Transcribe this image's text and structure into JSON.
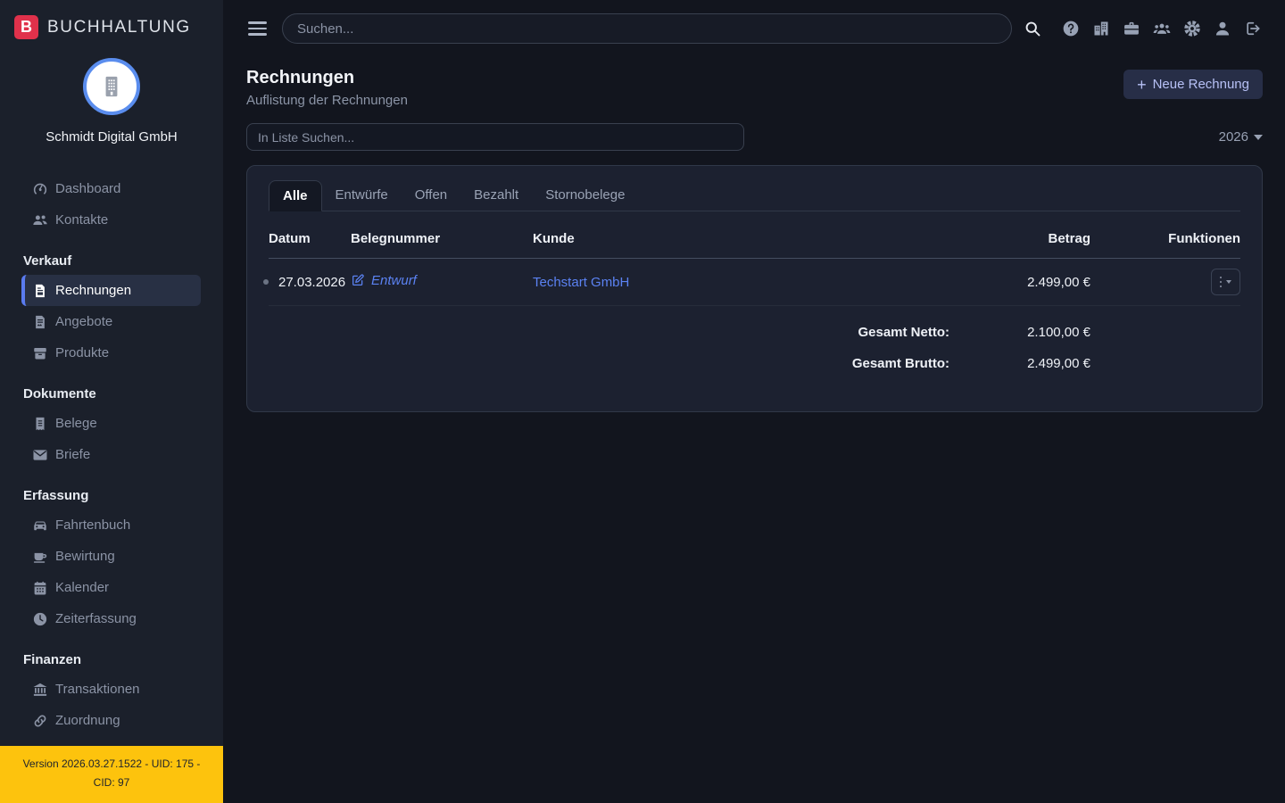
{
  "app": {
    "brand": "BUCHHALTUNG",
    "logo_letter": "B"
  },
  "colors": {
    "accent_blue": "#5b82f2",
    "active_item_bar": "#5a7bf0",
    "avatar_ring": "#5a8dee",
    "version_bar_yellow": "#fdc30d",
    "logo_red": "#e0314b",
    "card_bg": "#1c2130",
    "page_bg": "#12151e",
    "sidebar_bg": "#1b202b"
  },
  "topbar": {
    "search_placeholder": "Suchen...",
    "icons": [
      "hamburger-icon",
      "search-icon",
      "help-circle-icon",
      "city-icon",
      "briefcase-icon",
      "users-icon",
      "gear-icon",
      "user-icon",
      "sign-out-icon"
    ]
  },
  "sidebar": {
    "company_name": "Schmidt Digital GmbH",
    "top_items": [
      {
        "label": "Dashboard",
        "icon": "gauge-icon"
      },
      {
        "label": "Kontakte",
        "icon": "users-icon"
      }
    ],
    "sections": [
      {
        "title": "Verkauf",
        "items": [
          {
            "label": "Rechnungen",
            "icon": "file-invoice-icon",
            "active": true
          },
          {
            "label": "Angebote",
            "icon": "file-lines-icon"
          },
          {
            "label": "Produkte",
            "icon": "box-icon"
          }
        ]
      },
      {
        "title": "Dokumente",
        "items": [
          {
            "label": "Belege",
            "icon": "receipt-icon"
          },
          {
            "label": "Briefe",
            "icon": "envelope-icon"
          }
        ]
      },
      {
        "title": "Erfassung",
        "items": [
          {
            "label": "Fahrtenbuch",
            "icon": "car-icon"
          },
          {
            "label": "Bewirtung",
            "icon": "coffee-icon"
          },
          {
            "label": "Kalender",
            "icon": "calendar-icon"
          },
          {
            "label": "Zeiterfassung",
            "icon": "clock-icon"
          }
        ]
      },
      {
        "title": "Finanzen",
        "items": [
          {
            "label": "Transaktionen",
            "icon": "bank-icon"
          },
          {
            "label": "Zuordnung",
            "icon": "link-icon"
          }
        ]
      }
    ],
    "version_text": "Version 2026.03.27.1522 - UID: 175 - CID: 97"
  },
  "page": {
    "title": "Rechnungen",
    "subtitle": "Auflistung der Rechnungen",
    "new_button_plus": "+",
    "new_button_label": "Neue Rechnung",
    "list_search_placeholder": "In Liste Suchen...",
    "year_filter": "2026"
  },
  "invoice_card": {
    "tabs": [
      "Alle",
      "Entwürfe",
      "Offen",
      "Bezahlt",
      "Stornobelege"
    ],
    "active_tab": "Alle",
    "table": {
      "headers": [
        "Datum",
        "Belegnummer",
        "Kunde",
        "Betrag",
        "Funktionen"
      ],
      "rows": [
        {
          "datum": "27.03.2026",
          "belegnummer_status": "Entwurf",
          "kunde": "Techstart GmbH",
          "betrag": "2.499,00 €"
        }
      ]
    },
    "totals": [
      {
        "label": "Gesamt Netto:",
        "value": "2.100,00 €"
      },
      {
        "label": "Gesamt Brutto:",
        "value": "2.499,00 €"
      }
    ]
  }
}
